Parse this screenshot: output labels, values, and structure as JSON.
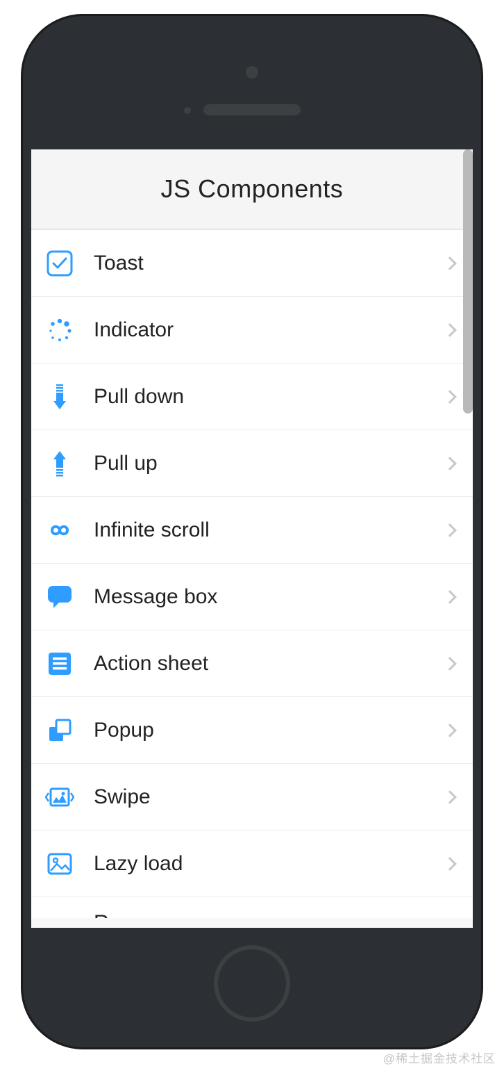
{
  "header": {
    "title": "JS Components"
  },
  "list": {
    "items": [
      {
        "label": "Toast",
        "icon": "toast-icon"
      },
      {
        "label": "Indicator",
        "icon": "indicator-icon"
      },
      {
        "label": "Pull down",
        "icon": "pull-down-icon"
      },
      {
        "label": "Pull up",
        "icon": "pull-up-icon"
      },
      {
        "label": "Infinite scroll",
        "icon": "infinite-icon"
      },
      {
        "label": "Message box",
        "icon": "message-box-icon"
      },
      {
        "label": "Action sheet",
        "icon": "action-sheet-icon"
      },
      {
        "label": "Popup",
        "icon": "popup-icon"
      },
      {
        "label": "Swipe",
        "icon": "swipe-icon"
      },
      {
        "label": "Lazy load",
        "icon": "lazy-load-icon"
      }
    ],
    "partial_next": {
      "label": "Range",
      "icon": "range-icon"
    }
  },
  "colors": {
    "accent": "#2e9dff",
    "chevron": "#c8c8c8",
    "border": "#ebebeb"
  },
  "watermark": "@稀土掘金技术社区"
}
